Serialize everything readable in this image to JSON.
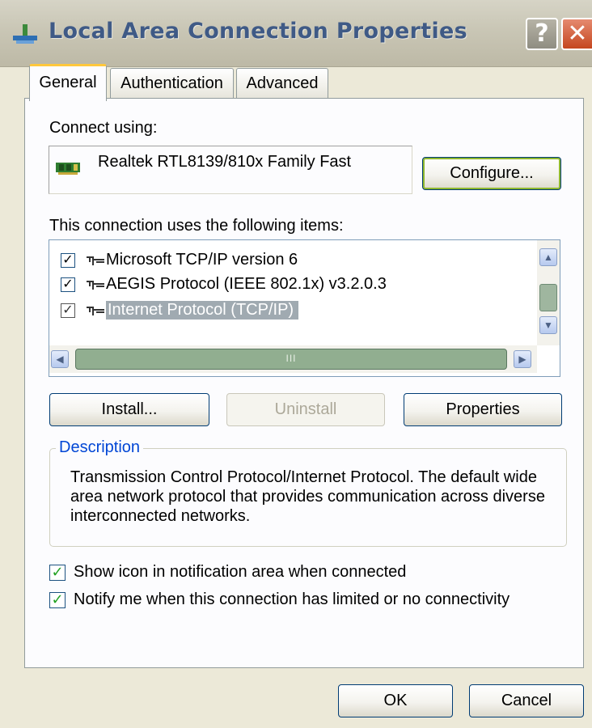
{
  "window": {
    "title": "Local Area Connection Properties",
    "help_label": "?",
    "close_label": "✕"
  },
  "tabs": [
    {
      "label": "General",
      "active": true
    },
    {
      "label": "Authentication",
      "active": false
    },
    {
      "label": "Advanced",
      "active": false
    }
  ],
  "general": {
    "connect_using_label": "Connect using:",
    "adapter_name": "Realtek RTL8139/810x Family Fast",
    "configure_label": "Configure...",
    "items_label": "This connection uses the following items:",
    "items": [
      {
        "label": "Microsoft TCP/IP version 6",
        "checked": true,
        "selected": false
      },
      {
        "label": "AEGIS Protocol (IEEE 802.1x) v3.2.0.3",
        "checked": true,
        "selected": false
      },
      {
        "label": "Internet Protocol (TCP/IP)",
        "checked": true,
        "selected": true
      }
    ],
    "scroll_thumb_grip": "III",
    "install_label": "Install...",
    "uninstall_label": "Uninstall",
    "properties_label": "Properties",
    "description_title": "Description",
    "description_text": "Transmission Control Protocol/Internet Protocol. The default wide area network protocol that provides communication across diverse interconnected networks.",
    "options": [
      {
        "label": "Show icon in notification area when connected",
        "checked": true
      },
      {
        "label": "Notify me when this connection has limited or no connectivity",
        "checked": true
      }
    ]
  },
  "footer": {
    "ok_label": "OK",
    "cancel_label": "Cancel"
  },
  "icons": {
    "title": "network-connection-icon",
    "adapter": "network-adapter-icon",
    "protocol": "network-protocol-icon"
  },
  "colors": {
    "title_text": "#3f5a86",
    "active_tab_accent": "#ffc83c",
    "selection": "#a0aab1",
    "group_title": "#0046d5",
    "close_button": "#c5461f",
    "checkmark": "#21a121"
  }
}
